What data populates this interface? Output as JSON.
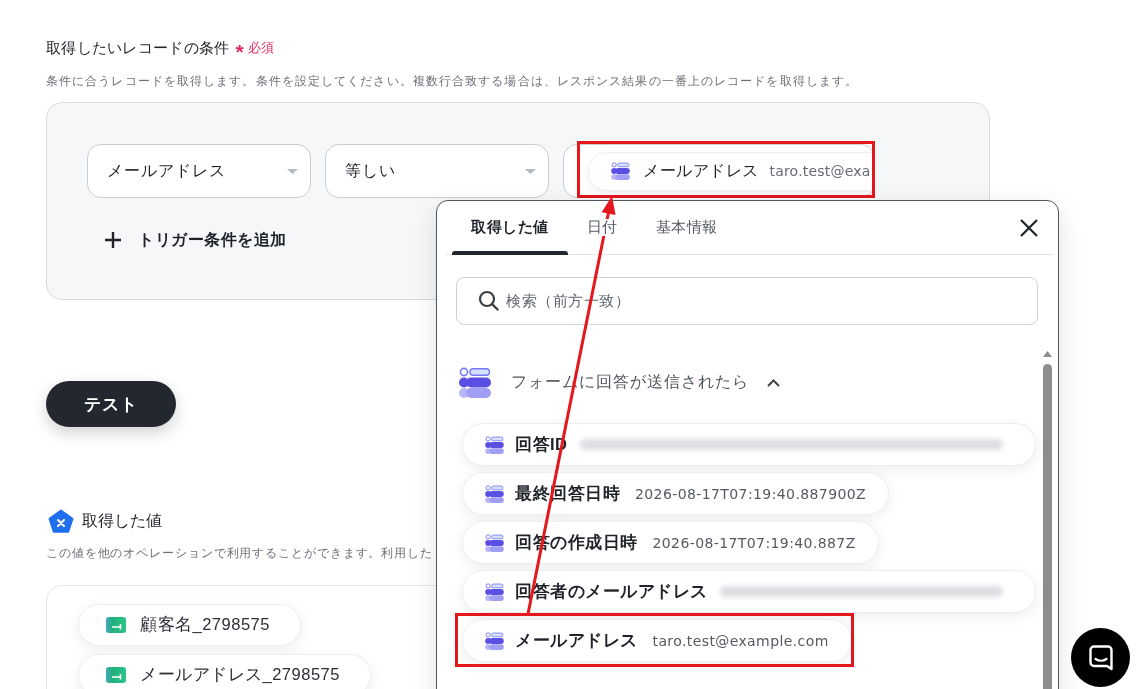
{
  "condition_section": {
    "title": "取得したいレコードの条件",
    "required_mark": "*",
    "required_label": "必須",
    "description": "条件に合うレコードを取得します。条件を設定してください。複数行合致する場合は、レスポンス結果の一番上のレコードを取得します。",
    "conditions": [
      {
        "field": "メールアドレス",
        "operator": "等しい",
        "value_chip": {
          "label": "メールアドレス",
          "value": "taro.test@exa",
          "highlighted": true
        }
      }
    ],
    "add_condition_label": "トリガー条件を追加"
  },
  "test_button": {
    "label": "テスト"
  },
  "output_section": {
    "title": "取得した値",
    "description": "この値を他のオペレーションで利用することができます。利用した",
    "values": [
      {
        "label": "顧客名_2798575"
      },
      {
        "label": "メールアドレス_2798575"
      }
    ]
  },
  "value_picker": {
    "tabs": [
      {
        "label": "取得した値",
        "selected": true
      },
      {
        "label": "日付",
        "selected": false
      },
      {
        "label": "基本情報",
        "selected": false
      }
    ],
    "search": {
      "placeholder": "検索（前方一致）"
    },
    "groups": [
      {
        "title": "フォームに回答が送信されたら",
        "expanded": true,
        "items": [
          {
            "label": "回答ID",
            "value_blurred": true,
            "highlighted": false
          },
          {
            "label": "最終回答日時",
            "value": "2026-08-17T07:19:40.887900Z",
            "value_blurred": false,
            "highlighted": false
          },
          {
            "label": "回答の作成日時",
            "value": "2026-08-17T07:19:40.887Z",
            "value_blurred": false,
            "highlighted": false
          },
          {
            "label": "回答者のメールアドレス",
            "value_blurred": true,
            "highlighted": false
          },
          {
            "label": "メールアドレス",
            "value": "taro.test@example.com",
            "value_blurred": false,
            "highlighted": true
          }
        ]
      }
    ]
  }
}
